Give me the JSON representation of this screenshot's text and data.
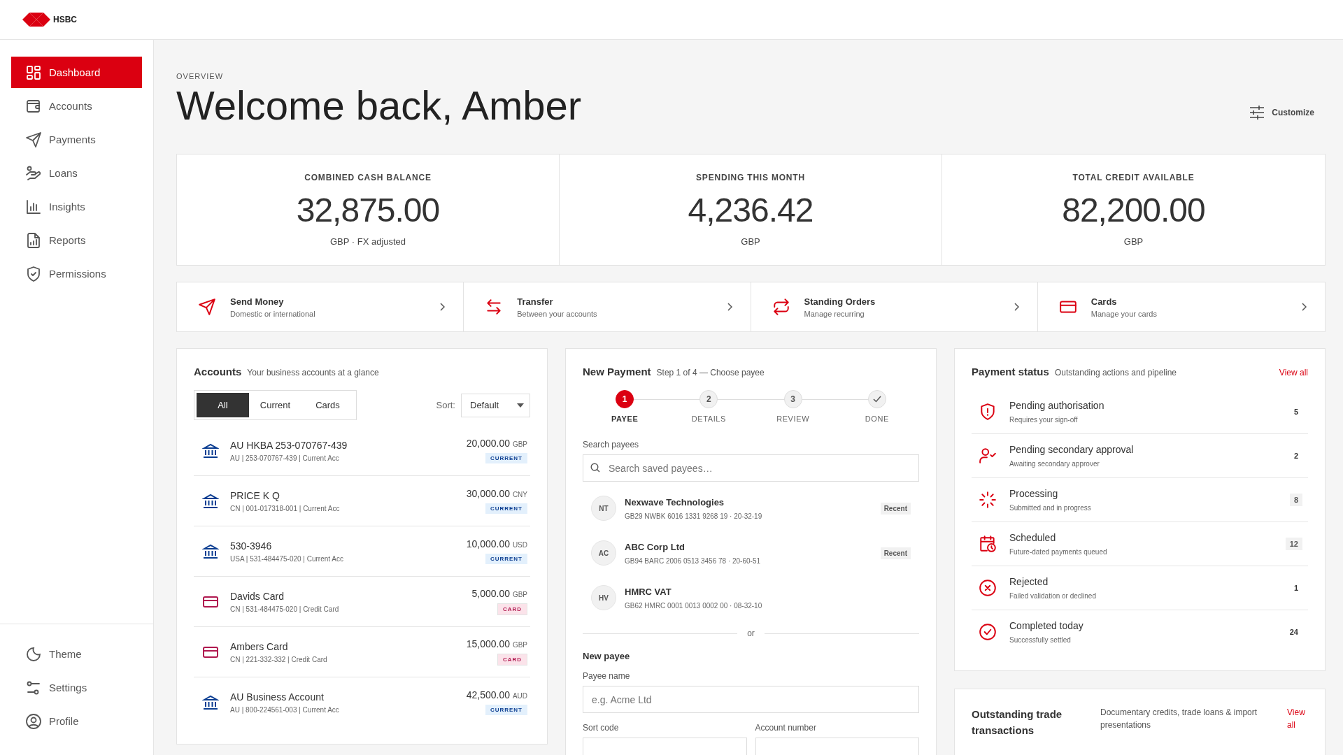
{
  "header": {
    "logo": "HSBC"
  },
  "sidebar": {
    "items": [
      {
        "label": "Dashboard",
        "kind": "grid",
        "selected": true
      },
      {
        "label": "Accounts",
        "kind": "wallet",
        "selected": false
      },
      {
        "label": "Payments",
        "kind": "send",
        "selected": false
      },
      {
        "label": "Loans",
        "kind": "loan",
        "selected": false
      },
      {
        "label": "Insights",
        "kind": "chart",
        "selected": false
      },
      {
        "label": "Reports",
        "kind": "report",
        "selected": false
      },
      {
        "label": "Permissions",
        "kind": "shield",
        "selected": false
      }
    ],
    "footer_items": [
      {
        "label": "Theme",
        "kind": "moon"
      },
      {
        "label": "Settings",
        "kind": "sliders"
      },
      {
        "label": "Profile",
        "kind": "user"
      }
    ]
  },
  "overview": {
    "eyebrow": "OVERVIEW",
    "title": "Welcome back, Amber",
    "customize": "Customize"
  },
  "stats": [
    {
      "label": "COMBINED CASH BALANCE",
      "value": "32,875.00",
      "note": "GBP · FX adjusted"
    },
    {
      "label": "SPENDING THIS MONTH",
      "value": "4,236.42",
      "note": "GBP"
    },
    {
      "label": "TOTAL CREDIT AVAILABLE",
      "value": "82,200.00",
      "note": "GBP"
    }
  ],
  "quick_actions": [
    {
      "title": "Send Money",
      "subtitle": "Domestic or international",
      "kind": "send"
    },
    {
      "title": "Transfer",
      "subtitle": "Between your accounts",
      "kind": "transfer"
    },
    {
      "title": "Standing Orders",
      "subtitle": "Manage recurring",
      "kind": "repeat"
    },
    {
      "title": "Cards",
      "subtitle": "Manage your cards",
      "kind": "card"
    }
  ],
  "accounts": {
    "title": "Accounts",
    "subtitle": "Your business accounts at a glance",
    "filters": [
      {
        "label": "All",
        "selected": true
      },
      {
        "label": "Current",
        "selected": false
      },
      {
        "label": "Cards",
        "selected": false
      }
    ],
    "sort_label": "Sort:",
    "sort_value": "Default",
    "rows": [
      {
        "kind": "bank",
        "name": "AU HKBA 253-070767-439",
        "detail": "AU | 253-070767-439 | Current Acc",
        "amount": "20,000.00",
        "currency": "GBP",
        "tag": "CURRENT"
      },
      {
        "kind": "bank",
        "name": "PRICE K Q",
        "detail": "CN | 001-017318-001 | Current Acc",
        "amount": "30,000.00",
        "currency": "CNY",
        "tag": "CURRENT"
      },
      {
        "kind": "bank",
        "name": "530-3946",
        "detail": "USA | 531-484475-020 | Current Acc",
        "amount": "10,000.00",
        "currency": "USD",
        "tag": "CURRENT"
      },
      {
        "kind": "card",
        "name": "Davids Card",
        "detail": "CN | 531-484475-020 | Credit Card",
        "amount": "5,000.00",
        "currency": "GBP",
        "tag": "CARD"
      },
      {
        "kind": "card",
        "name": "Ambers Card",
        "detail": "CN | 221-332-332 | Credit Card",
        "amount": "15,000.00",
        "currency": "GBP",
        "tag": "CARD"
      },
      {
        "kind": "bank",
        "name": "AU Business Account",
        "detail": "AU | 800-224561-003 | Current Acc",
        "amount": "42,500.00",
        "currency": "AUD",
        "tag": "CURRENT"
      }
    ]
  },
  "new_payment": {
    "title": "New Payment",
    "subtitle": "Step 1 of 4 — Choose payee",
    "steps": [
      {
        "kind": "number",
        "number": "1",
        "label": "PAYEE",
        "selected": true
      },
      {
        "kind": "number",
        "number": "2",
        "label": "DETAILS",
        "selected": false
      },
      {
        "kind": "number",
        "number": "3",
        "label": "REVIEW",
        "selected": false
      },
      {
        "kind": "check",
        "label": "DONE",
        "selected": false
      }
    ],
    "search_label": "Search payees",
    "search_placeholder": "Search saved payees…",
    "payees": [
      {
        "initials": "NT",
        "name": "Nexwave Technologies",
        "detail": "GB29 NWBK 6016 1331 9268 19 · 20-32-19",
        "badge": "Recent"
      },
      {
        "initials": "AC",
        "name": "ABC Corp Ltd",
        "detail": "GB94 BARC 2006 0513 3456 78 · 20-60-51",
        "badge": "Recent"
      },
      {
        "initials": "HV",
        "name": "HMRC VAT",
        "detail": "GB62 HMRC 0001 0013 0002 00 · 08-32-10"
      }
    ],
    "divider": "or",
    "new_payee_title": "New payee",
    "payee_name_label": "Payee name",
    "payee_name_placeholder": "e.g. Acme Ltd",
    "sort_code_label": "Sort code",
    "account_number_label": "Account number"
  },
  "payment_status": {
    "title": "Payment status",
    "subtitle": "Outstanding actions and pipeline",
    "link": "View all",
    "items": [
      {
        "kind": "shield-alert",
        "title": "Pending authorisation",
        "subtitle": "Requires your sign-off",
        "count": "5",
        "boxed": false
      },
      {
        "kind": "user-check",
        "title": "Pending secondary approval",
        "subtitle": "Awaiting secondary approver",
        "count": "2",
        "boxed": false
      },
      {
        "kind": "loader",
        "title": "Processing",
        "subtitle": "Submitted and in progress",
        "count": "8",
        "boxed": true
      },
      {
        "kind": "calendar",
        "title": "Scheduled",
        "subtitle": "Future-dated payments queued",
        "count": "12",
        "boxed": true
      },
      {
        "kind": "x-circle",
        "title": "Rejected",
        "subtitle": "Failed validation or declined",
        "count": "1",
        "boxed": false
      },
      {
        "kind": "check-circle",
        "title": "Completed today",
        "subtitle": "Successfully settled",
        "count": "24",
        "boxed": false
      }
    ]
  },
  "trade": {
    "title": "Outstanding trade transactions",
    "subtitle": "Documentary credits, trade loans & import presentations",
    "link": "View all"
  }
}
